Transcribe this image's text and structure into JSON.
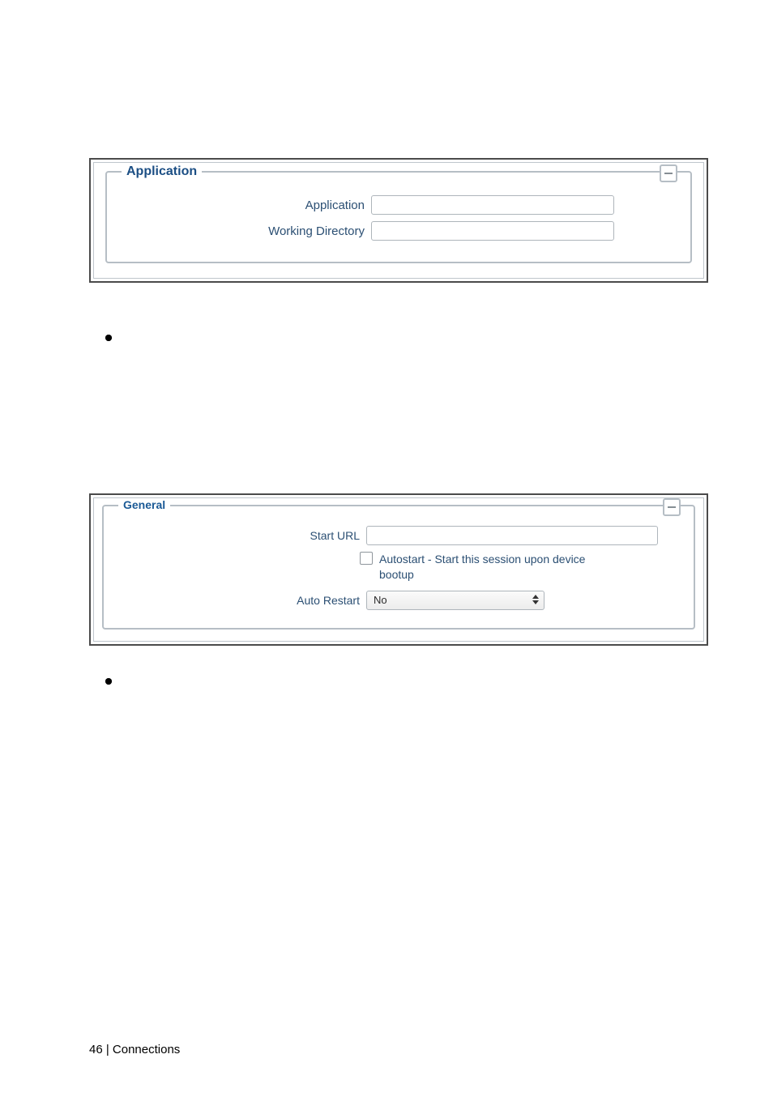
{
  "figure_a": {
    "legend": "Application",
    "fields": {
      "application_label": "Application",
      "working_dir_label": "Working Directory"
    }
  },
  "figure_b": {
    "legend": "General",
    "fields": {
      "start_url_label": "Start URL",
      "autostart_label": "Autostart - Start this session upon device bootup",
      "auto_restart_label": "Auto Restart",
      "auto_restart_value": "No"
    }
  },
  "footer": "46 | Connections"
}
